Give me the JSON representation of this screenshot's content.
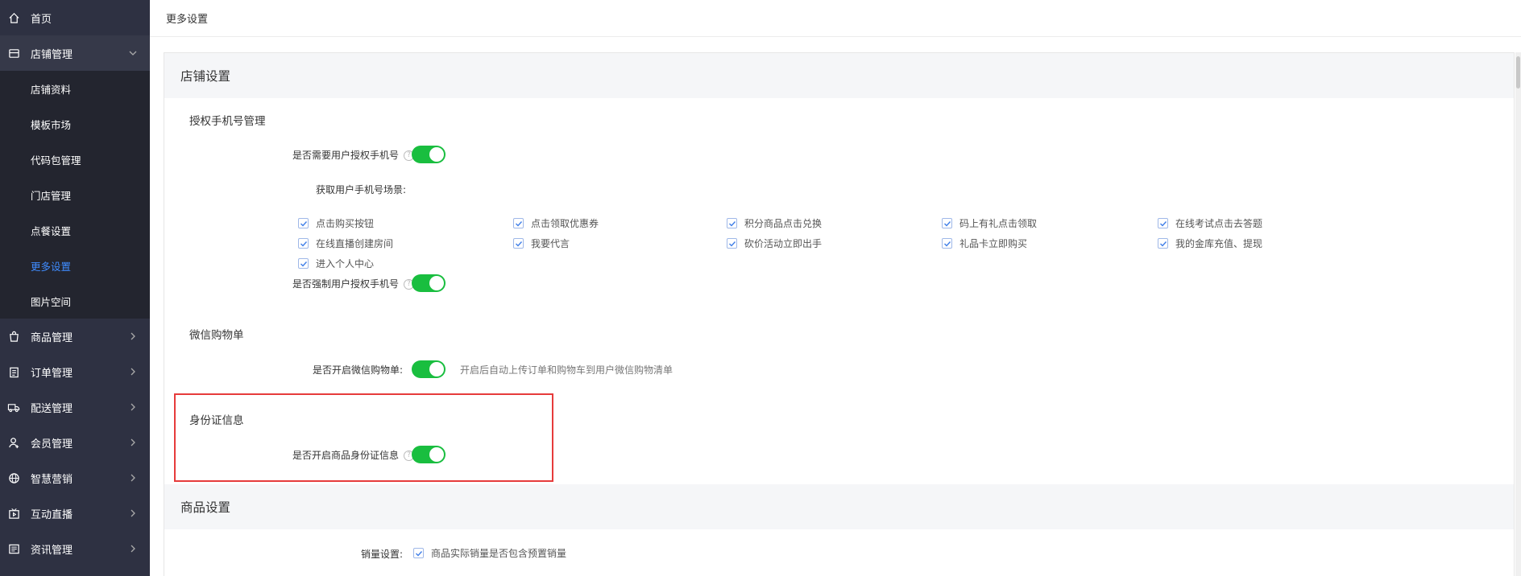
{
  "sidebar": {
    "items": [
      {
        "label": "首页",
        "icon": "home-icon"
      },
      {
        "label": "店铺管理",
        "icon": "store-icon"
      },
      {
        "label": "商品管理",
        "icon": "bag-icon"
      },
      {
        "label": "订单管理",
        "icon": "clipboard-icon"
      },
      {
        "label": "配送管理",
        "icon": "truck-icon"
      },
      {
        "label": "会员管理",
        "icon": "user-icon"
      },
      {
        "label": "智慧营销",
        "icon": "globe-icon"
      },
      {
        "label": "互动直播",
        "icon": "tv-icon"
      },
      {
        "label": "资讯管理",
        "icon": "news-icon"
      }
    ],
    "sub_items": [
      "店铺资料",
      "模板市场",
      "代码包管理",
      "门店管理",
      "点餐设置",
      "更多设置",
      "图片空间"
    ],
    "active_sub": "更多设置"
  },
  "topbar": {
    "title": "更多设置"
  },
  "store_settings": {
    "header": "店铺设置",
    "auth_phone": {
      "title": "授权手机号管理",
      "require_label": "是否需要用户授权手机号",
      "require_on": true,
      "scene_label": "获取用户手机号场景:",
      "scenes": [
        "点击购买按钮",
        "点击领取优惠券",
        "积分商品点击兑换",
        "码上有礼点击领取",
        "在线考试点击去答题",
        "在线直播创建房间",
        "我要代言",
        "砍价活动立即出手",
        "礼品卡立即购买",
        "我的金库充值、提现",
        "进入个人中心"
      ],
      "force_label": "是否强制用户授权手机号",
      "force_on": true
    },
    "wechat_cart": {
      "title": "微信购物单",
      "label": "是否开启微信购物单:",
      "on": true,
      "hint": "开启后自动上传订单和购物车到用户微信购物清单"
    },
    "id_info": {
      "title": "身份证信息",
      "label": "是否开启商品身份证信息",
      "on": true
    }
  },
  "goods_settings": {
    "header": "商品设置",
    "sales_label": "销量设置:",
    "sales_option": "商品实际销量是否包含预置销量"
  },
  "colors": {
    "switch_on": "#19be3f",
    "sidebar_bg": "#2e3142",
    "active_link": "#3f8cff",
    "highlight": "#e63b3b"
  }
}
